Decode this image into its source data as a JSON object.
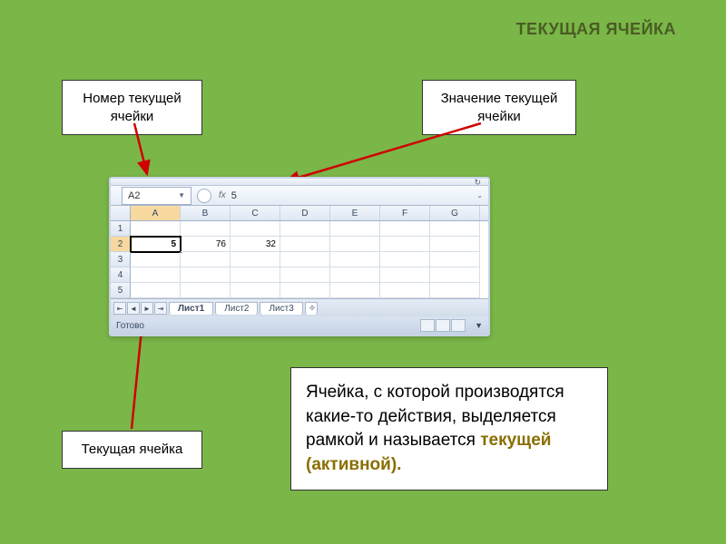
{
  "title": "ТЕКУЩАЯ ЯЧЕЙКА",
  "callouts": {
    "top_left": "Номер текущей ячейки",
    "top_right": "Значение текущей ячейки",
    "bottom_left": "Текущая ячейка"
  },
  "definition": {
    "prefix": "Ячейка, с которой производятся  какие-то действия, выделяется рамкой и называется ",
    "highlight": "текущей (активной)."
  },
  "excel": {
    "name_box": "A2",
    "fx_label": "fx",
    "formula_value": "5",
    "columns": [
      "A",
      "B",
      "C",
      "D",
      "E",
      "F",
      "G"
    ],
    "active_col": "A",
    "active_row": "2",
    "rows": [
      "1",
      "2",
      "3",
      "4",
      "5"
    ],
    "cells": {
      "A2": "5",
      "B2": "76",
      "C2": "32"
    },
    "sheets": [
      "Лист1",
      "Лист2",
      "Лист3"
    ],
    "active_sheet": "Лист1",
    "new_sheet_glyph": "✧",
    "status": "Готово",
    "nav": {
      "first": "⇤",
      "prev": "◄",
      "next": "►",
      "last": "⇥"
    },
    "icons": {
      "refresh": "↻",
      "dropdown": "▼",
      "expand": "⌄",
      "zoom_down": "▼"
    }
  },
  "colors": {
    "arrow": "#d00000"
  }
}
